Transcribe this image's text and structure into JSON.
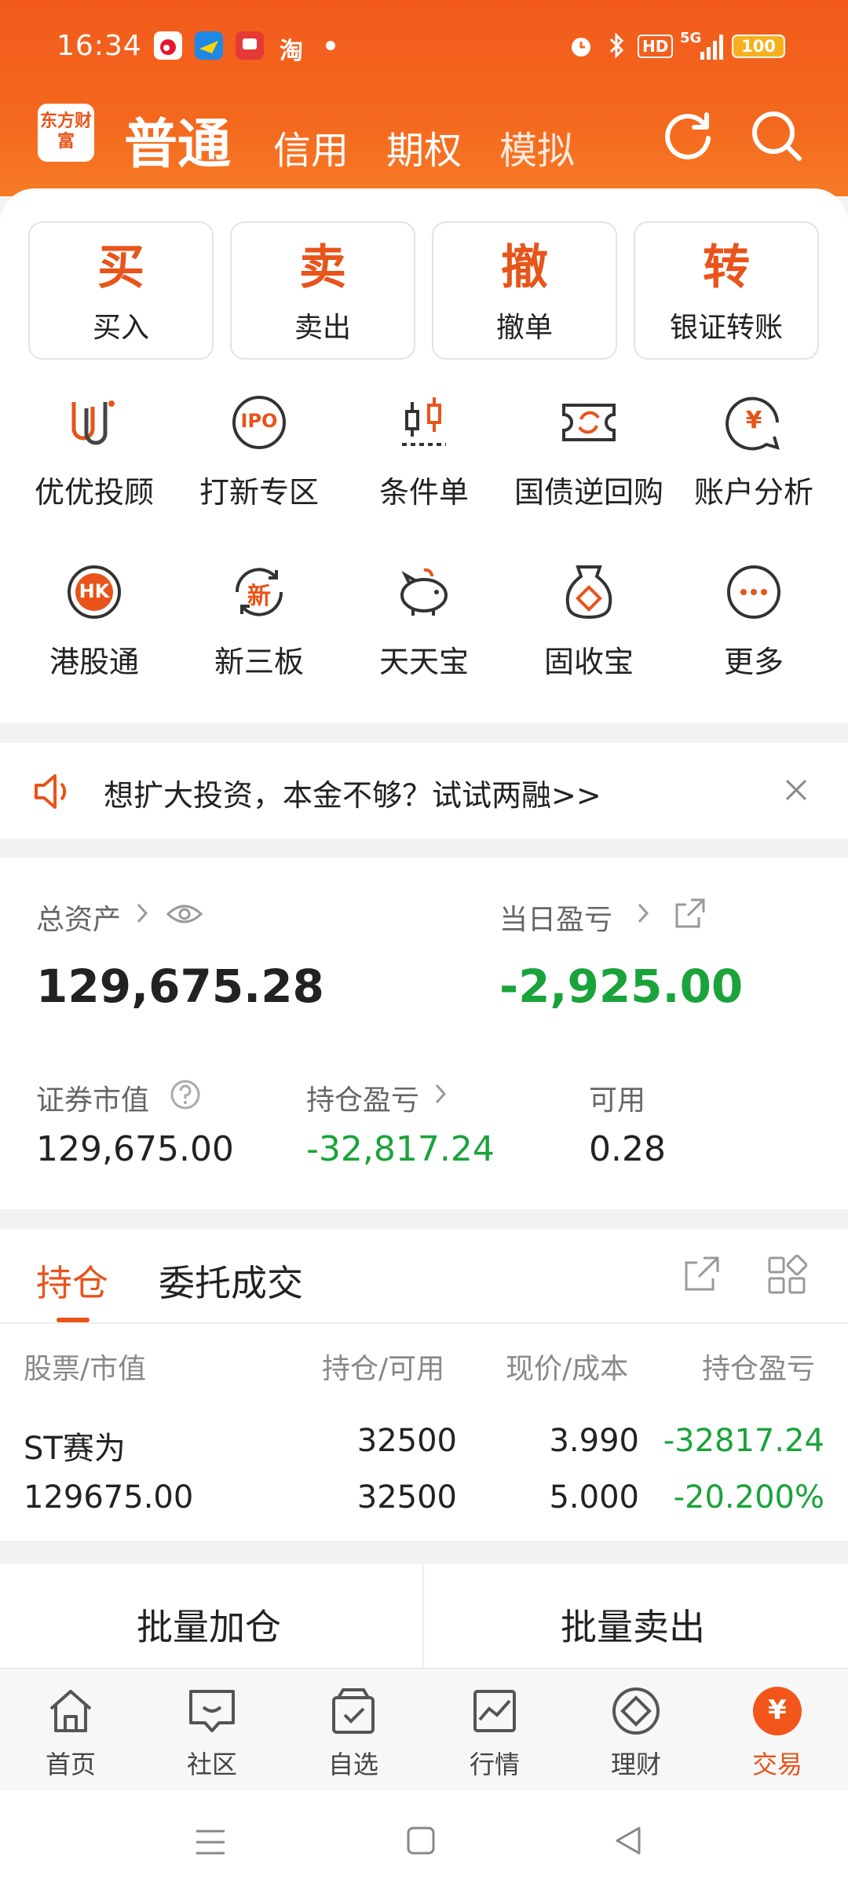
{
  "status_bar": {
    "time": "16:34",
    "app_taobao": "淘",
    "battery": "100",
    "network": "5G",
    "hd": "HD"
  },
  "header": {
    "logo_text": "东方财富",
    "tabs": [
      {
        "label": "普通"
      },
      {
        "label": "信用"
      },
      {
        "label": "期权"
      },
      {
        "label": "模拟"
      }
    ]
  },
  "actions": [
    {
      "big": "买",
      "small": "买入"
    },
    {
      "big": "卖",
      "small": "卖出"
    },
    {
      "big": "撤",
      "small": "撤单"
    },
    {
      "big": "转",
      "small": "银证转账"
    }
  ],
  "features": [
    {
      "label": "优优投顾",
      "icon": "uu-advisor-icon"
    },
    {
      "label": "打新专区",
      "icon": "ipo-icon",
      "icon_text": "IPO"
    },
    {
      "label": "条件单",
      "icon": "candlestick-icon"
    },
    {
      "label": "国债逆回购",
      "icon": "repo-icon"
    },
    {
      "label": "账户分析",
      "icon": "yuan-chat-icon",
      "icon_text": "¥"
    },
    {
      "label": "港股通",
      "icon": "hk-icon",
      "icon_text": "HK"
    },
    {
      "label": "新三板",
      "icon": "new-board-icon",
      "icon_text": "新"
    },
    {
      "label": "天天宝",
      "icon": "piggy-bank-icon"
    },
    {
      "label": "固收宝",
      "icon": "money-bag-icon"
    },
    {
      "label": "更多",
      "icon": "more-icon"
    }
  ],
  "banner": {
    "text": "想扩大投资，本金不够？试试两融>>"
  },
  "assets": {
    "total_label": "总资产",
    "total_value": "129,675.28",
    "daily_label": "当日盈亏",
    "daily_value": "-2,925.00",
    "market_label": "证券市值",
    "market_value": "129,675.00",
    "position_pnl_label": "持仓盈亏",
    "position_pnl_value": "-32,817.24",
    "available_label": "可用",
    "available_value": "0.28"
  },
  "holdings": {
    "tabs": [
      "持仓",
      "委托成交"
    ],
    "columns": [
      "股票/市值",
      "持仓/可用",
      "现价/成本",
      "持仓盈亏"
    ],
    "rows": [
      {
        "name": "ST赛为",
        "market_value": "129675.00",
        "position": "32500",
        "available": "32500",
        "price": "3.990",
        "cost": "5.000",
        "pnl": "-32817.24",
        "pnl_pct": "-20.200%"
      }
    ]
  },
  "batch": {
    "add": "批量加仓",
    "sell": "批量卖出"
  },
  "bottom_nav": [
    {
      "label": "首页",
      "icon": "home-icon"
    },
    {
      "label": "社区",
      "icon": "community-icon"
    },
    {
      "label": "自选",
      "icon": "watchlist-icon"
    },
    {
      "label": "行情",
      "icon": "market-icon"
    },
    {
      "label": "理财",
      "icon": "wealth-icon"
    },
    {
      "label": "交易",
      "icon": "trade-icon",
      "icon_text": "¥",
      "active": true
    }
  ],
  "colors": {
    "accent": "#e8541a",
    "header": "#f4681e",
    "gain_loss_green": "#1aa33a"
  }
}
